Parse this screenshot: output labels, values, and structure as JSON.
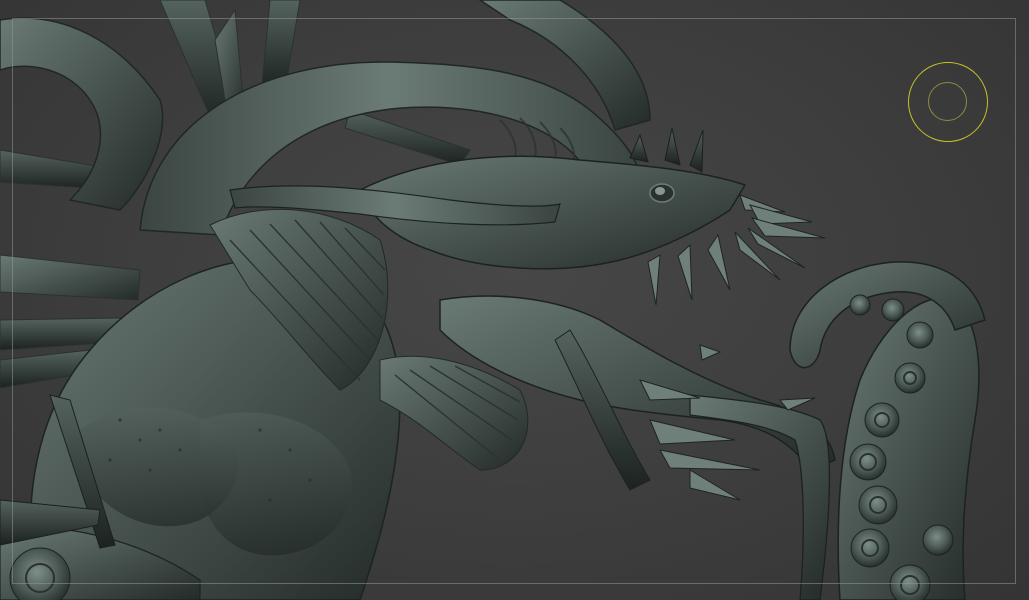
{
  "viewport": {
    "background_color": "#3f3f3f",
    "frame_guide_color": "#969696",
    "model_material_color": "#4e5a56",
    "model_highlight_color": "#8a9a93",
    "model_shadow_color": "#1f2523",
    "brush_outer_color": "#c9c12a",
    "brush_inner_color": "#8e8a3e"
  },
  "model": {
    "subject": "sea-serpent-dragon-sculpt",
    "parts": [
      "horn",
      "head",
      "jaw",
      "teeth",
      "fins",
      "body",
      "spikes",
      "tentacle",
      "suckers"
    ]
  },
  "brush": {
    "icon": "draw-size-ring-icon"
  }
}
